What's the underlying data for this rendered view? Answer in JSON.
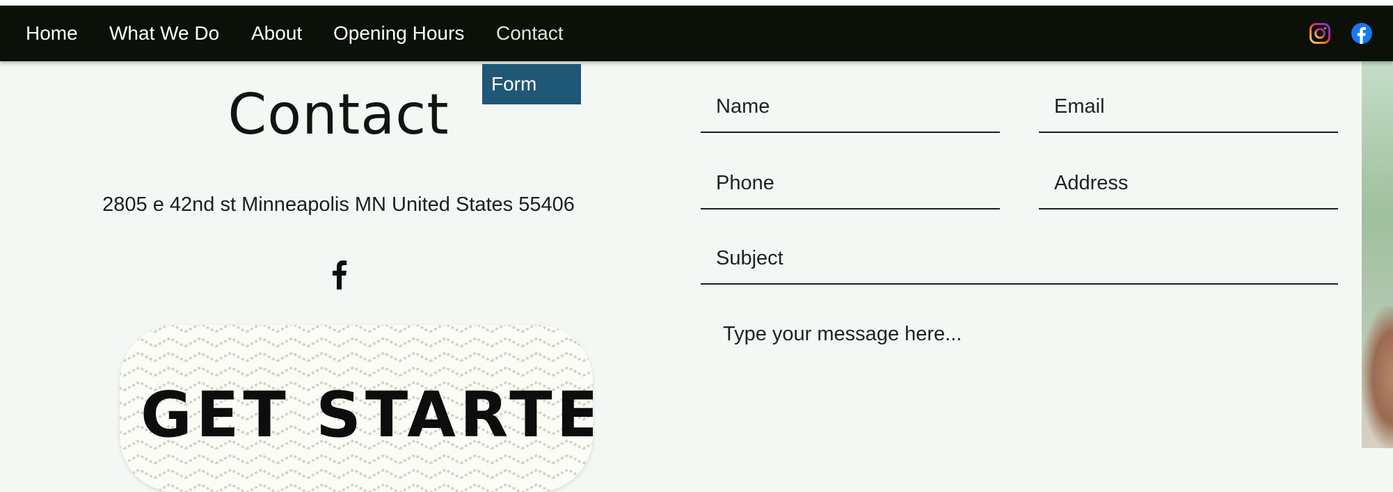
{
  "nav": {
    "items": [
      {
        "label": "Home"
      },
      {
        "label": "What We Do"
      },
      {
        "label": "About"
      },
      {
        "label": "Opening Hours"
      },
      {
        "label": "Contact"
      }
    ],
    "active": "Contact",
    "social": [
      {
        "name": "instagram-icon"
      },
      {
        "name": "facebook-icon"
      }
    ],
    "colors": {
      "bar": "#0b1108",
      "text": "#ffffff",
      "facebook": "#1877f2"
    }
  },
  "dropdown": {
    "items": [
      {
        "label": "Form"
      }
    ],
    "color": "#1f5776"
  },
  "contact": {
    "title": "Contact",
    "address": "2805 e 42nd st Minneapolis MN United States 55406",
    "cta": "GET STARTED!"
  },
  "form": {
    "name_label": "Name",
    "email_label": "Email",
    "phone_label": "Phone",
    "address_label": "Address",
    "subject_label": "Subject",
    "message_placeholder": "Type your message here..."
  }
}
